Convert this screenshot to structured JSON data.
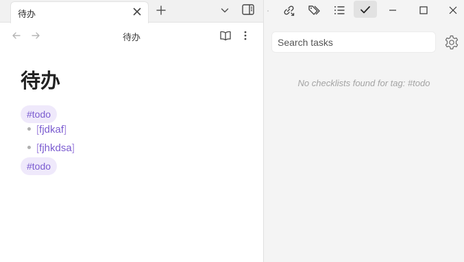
{
  "tab": {
    "title": "待办"
  },
  "view": {
    "title": "待办"
  },
  "note": {
    "heading": "待办",
    "tags": [
      "#todo",
      "#todo"
    ],
    "items": [
      {
        "open": "[",
        "text": "fjdkaf",
        "close": "]"
      },
      {
        "open": "[",
        "text": "fjhkdsa",
        "close": "]"
      }
    ]
  },
  "tasks_panel": {
    "search_placeholder": "Search tasks",
    "empty_message": "No checklists found for tag: #todo"
  },
  "icons": {
    "tab_close": "close-icon",
    "new_tab": "plus-icon",
    "tab_list": "chevron-down-icon",
    "sidebar_toggle": "sidebar-toggle-icon",
    "back": "arrow-left-icon",
    "forward": "arrow-right-icon",
    "reading_view": "book-open-icon",
    "more": "more-vertical-icon",
    "outgoing_links": "links-icon",
    "tags": "tags-icon",
    "outline": "list-icon",
    "checklist": "check-icon",
    "minimize": "minimize-icon",
    "maximize": "maximize-icon",
    "close_window": "close-icon",
    "settings": "gear-icon"
  },
  "colors": {
    "tag_bg": "#efe9fb",
    "tag_text": "#7a5bd0",
    "pane_bg": "#f4f4f4"
  }
}
